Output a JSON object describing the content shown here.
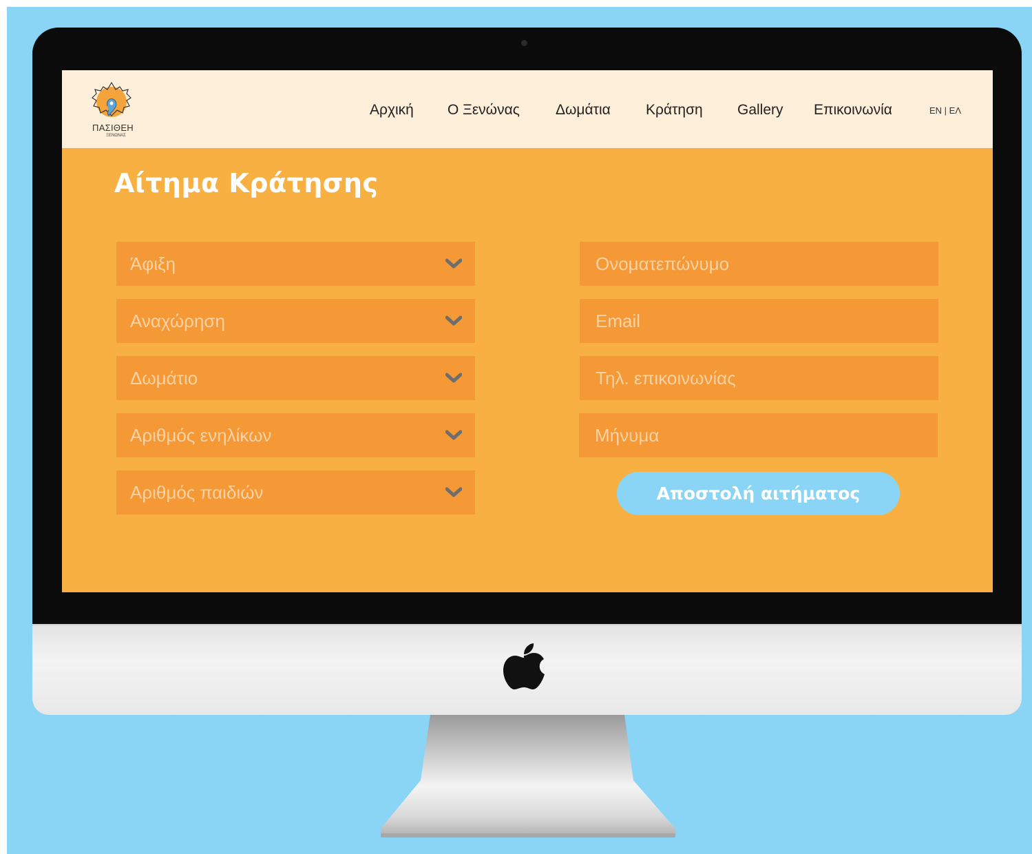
{
  "brand": {
    "name": "ΠΑΣΙΘΕΗ",
    "subtitle": "ΞΕΝΩΝΑΣ"
  },
  "nav": {
    "items": [
      {
        "label": "Αρχική"
      },
      {
        "label": "Ο Ξενώνας"
      },
      {
        "label": "Δωμάτια"
      },
      {
        "label": "Κράτηση"
      },
      {
        "label": "Gallery"
      },
      {
        "label": "Επικοινωνία"
      }
    ],
    "language_switch": "EN | ΕΛ"
  },
  "form": {
    "title": "Αίτημα Κράτησης",
    "left_fields": [
      {
        "label": "Άφιξη",
        "icon": "chevron-down-icon"
      },
      {
        "label": "Αναχώρηση",
        "icon": "chevron-down-icon"
      },
      {
        "label": "Δωμάτιο",
        "icon": "chevron-down-icon"
      },
      {
        "label": "Αριθμός ενηλίκων",
        "icon": "chevron-down-icon"
      },
      {
        "label": "Αριθμός παιδιών",
        "icon": "chevron-down-icon"
      }
    ],
    "right_fields": [
      {
        "placeholder": "Ονοματεπώνυμο"
      },
      {
        "placeholder": "Email"
      },
      {
        "placeholder": "Τηλ. επικοινωνίας"
      },
      {
        "placeholder": "Μήνυμα"
      }
    ],
    "submit_label": "Αποστολή αιτήματος"
  },
  "colors": {
    "page_background": "#8ad5f5",
    "navbar": "#fdefd9",
    "form_background": "#f9b043",
    "field_fill": "#f59937",
    "field_text": "#fad2a4",
    "submit_button": "#8ad5f5"
  }
}
